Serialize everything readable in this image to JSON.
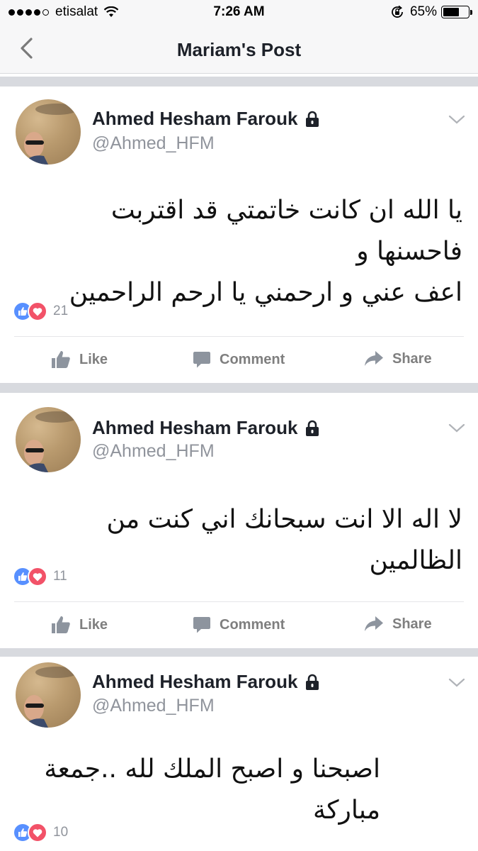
{
  "status_bar": {
    "carrier": "etisalat",
    "time": "7:26 AM",
    "battery_percent": "65%",
    "battery_level": 0.65,
    "icons": [
      "signal-dots",
      "wifi-icon",
      "rotation-lock-icon",
      "battery-icon"
    ]
  },
  "nav": {
    "back_icon": "chevron-left-icon",
    "title": "Mariam's Post"
  },
  "posts": [
    {
      "author": "Ahmed Hesham Farouk",
      "handle": "@Ahmed_HFM",
      "privacy_icon": "lock-icon",
      "lines": [
        "يا الله ان كانت خاتمتي قد اقتربت فاحسنها و",
        "اعف عني و ارحمني يا ارحم الراحمين"
      ],
      "reaction_count": "21",
      "actions": {
        "like": "Like",
        "comment": "Comment",
        "share": "Share"
      }
    },
    {
      "author": "Ahmed Hesham Farouk",
      "handle": "@Ahmed_HFM",
      "privacy_icon": "lock-icon",
      "lines": [
        "لا اله الا انت سبحانك اني كنت من الظالمين"
      ],
      "reaction_count": "11",
      "actions": {
        "like": "Like",
        "comment": "Comment",
        "share": "Share"
      }
    },
    {
      "author": "Ahmed Hesham Farouk",
      "handle": "@Ahmed_HFM",
      "privacy_icon": "lock-icon",
      "lines": [
        "اصبحنا و اصبح الملك لله ..جمعة مباركة"
      ],
      "reaction_count": "10"
    }
  ],
  "colors": {
    "like_blue": "#5890ff",
    "love_red": "#f25268",
    "divider_gray": "#d8dadf",
    "secondary_text": "#90949c"
  }
}
